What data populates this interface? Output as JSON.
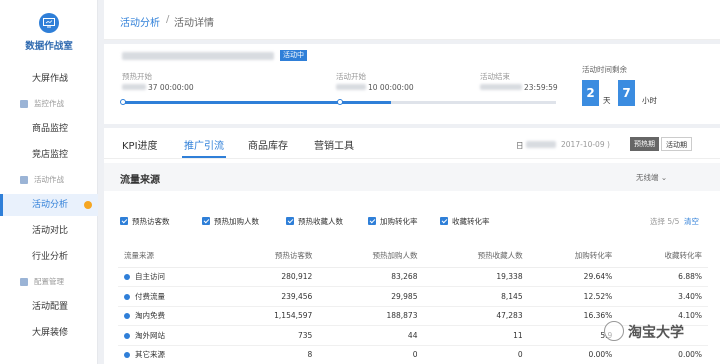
{
  "sidebar": {
    "title": "数据作战室",
    "items": [
      {
        "label": "大屏作战",
        "type": "item"
      },
      {
        "label": "监控作战",
        "type": "group"
      },
      {
        "label": "商品监控",
        "type": "item"
      },
      {
        "label": "竞店监控",
        "type": "item"
      },
      {
        "label": "活动作战",
        "type": "group"
      },
      {
        "label": "活动分析",
        "type": "item",
        "active": true
      },
      {
        "label": "活动对比",
        "type": "item"
      },
      {
        "label": "行业分析",
        "type": "item"
      },
      {
        "label": "配置管理",
        "type": "group"
      },
      {
        "label": "活动配置",
        "type": "item"
      },
      {
        "label": "大屏装修",
        "type": "item"
      }
    ]
  },
  "breadcrumb": {
    "parent": "活动分析",
    "separator": "/",
    "current": "活动详情"
  },
  "activity": {
    "status": "活动中",
    "presale_label": "预热开始",
    "presale_value": "37 00:00:00",
    "start_label": "活动开始",
    "start_value": "10 00:00:00",
    "end_label": "活动结束",
    "end_value": "23:59:59",
    "progress": 0.62,
    "remain_label": "活动时间剩余",
    "remain_days": "2",
    "days_unit": "天",
    "remain_hours": "7",
    "hours_unit": "小时"
  },
  "tabs": [
    {
      "label": "KPI进度"
    },
    {
      "label": "推广引流",
      "active": true
    },
    {
      "label": "商品库存"
    },
    {
      "label": "营销工具"
    }
  ],
  "date_range": {
    "prefix": "日",
    "end": "2017-10-09 )"
  },
  "period_toggle": {
    "presale": "预热期",
    "activity": "活动期"
  },
  "traffic": {
    "title": "流量来源",
    "compare": "无线端 ⌄",
    "metrics": [
      "预热访客数",
      "预热加购人数",
      "预热收藏人数",
      "加购转化率",
      "收藏转化率"
    ],
    "select_count": "选择 5/5",
    "clear": "清空",
    "columns": [
      "流量来源",
      "预热访客数",
      "预热加购人数",
      "预热收藏人数",
      "加购转化率",
      "收藏转化率"
    ],
    "rows": [
      [
        "自主访问",
        "280,912",
        "83,268",
        "19,338",
        "29.64%",
        "6.88%"
      ],
      [
        "付费流量",
        "239,456",
        "29,985",
        "8,145",
        "12.52%",
        "3.40%"
      ],
      [
        "淘内免费",
        "1,154,597",
        "188,873",
        "47,283",
        "16.36%",
        "4.10%"
      ],
      [
        "淘外网站",
        "735",
        "44",
        "11",
        "5.9",
        ""
      ],
      [
        "其它来源",
        "8",
        "0",
        "0",
        "0.00%",
        "0.00%"
      ]
    ]
  },
  "watermark": {
    "text": "淘宝大学"
  }
}
